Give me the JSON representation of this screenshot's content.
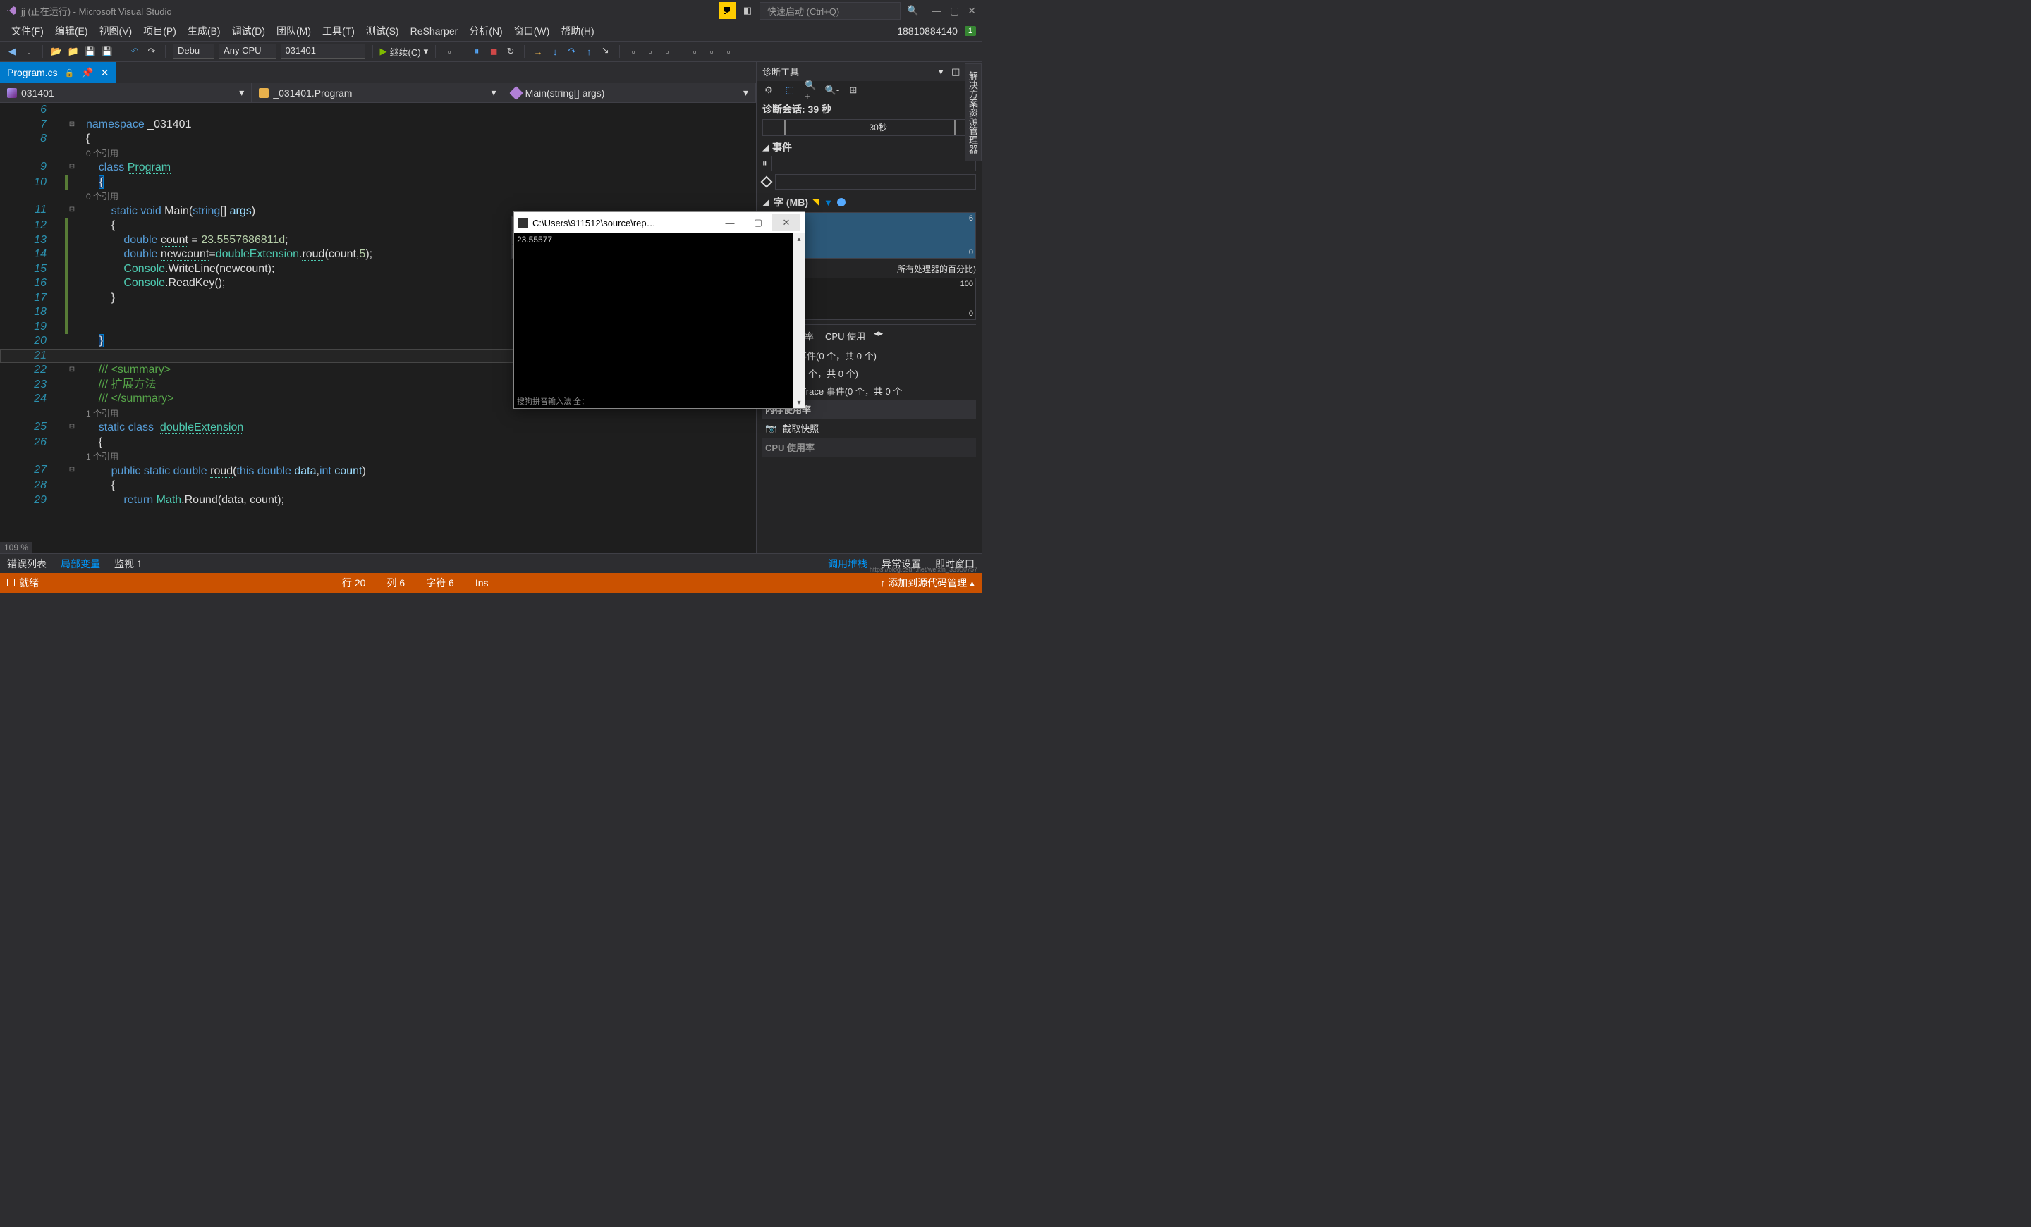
{
  "title": "jj (正在运行) - Microsoft Visual Studio",
  "quicklaunch_placeholder": "快速启动 (Ctrl+Q)",
  "user": "18810884140",
  "badge": "1",
  "menu": [
    "文件(F)",
    "编辑(E)",
    "视图(V)",
    "项目(P)",
    "生成(B)",
    "调试(D)",
    "团队(M)",
    "工具(T)",
    "测试(S)",
    "ReSharper",
    "分析(N)",
    "窗口(W)",
    "帮助(H)"
  ],
  "toolbar": {
    "config": "Debu",
    "platform": "Any CPU",
    "project": "031401",
    "continue": "继续(C)"
  },
  "tab": {
    "name": "Program.cs"
  },
  "nav": {
    "project": "031401",
    "class": "_031401.Program",
    "method": "Main(string[] args)"
  },
  "code": {
    "lines": [
      6,
      7,
      8,
      9,
      10,
      11,
      12,
      13,
      14,
      15,
      16,
      17,
      18,
      19,
      20,
      21,
      22,
      23,
      24,
      25,
      26,
      27,
      28,
      29
    ],
    "ref0": "0 个引用",
    "ref1": "1 个引用",
    "namespace": "namespace",
    "ns_name": "_031401",
    "class_kw": "class",
    "class_name": "Program",
    "static": "static",
    "void": "void",
    "main": "Main",
    "string": "string",
    "args_p": "args",
    "double": "double",
    "count_v": "count",
    "count_val": "23.5557686811d",
    "newcount": "newcount",
    "ext_class": "doubleExtension",
    "roud": "roud",
    "five": "5",
    "console": "Console",
    "writeline": "WriteLine",
    "readkey": "ReadKey",
    "summary_open": "/// <summary>",
    "summary_text": "/// 扩展方法",
    "summary_close": "/// </summary>",
    "public": "public",
    "this": "this",
    "data_p": "data",
    "int": "int",
    "return": "return",
    "math": "Math",
    "round": "Round"
  },
  "zoom": "109 %",
  "diag": {
    "title": "诊断工具",
    "session": "诊断会话: 39 秒",
    "timeline_label": "30秒",
    "events": "事件",
    "memory_header": "(MB)",
    "memory_suffix_cn": "字",
    "mem_top": "6",
    "mem_bot": "0",
    "cpu_caption": "所有处理器的百分比)",
    "cpu_top": "100",
    "cpu_bot": "0",
    "tabs": {
      "memusage": "内存使用率",
      "cpuusage": "CPU 使用"
    },
    "all_events": "所有事件(0 个，共 0 个)",
    "exceptions": "异常(0 个，共 0 个)",
    "intellitrace": "IntelliTrace 事件(0 个，共 0 个",
    "mem_section": "内存使用率",
    "snapshot": "截取快照",
    "cpu_section": "CPU 使用率"
  },
  "solution_explorer": "解决方案资源管理器",
  "bottom_tabs_left": {
    "errors": "错误列表",
    "locals": "局部变量",
    "watch": "监视 1"
  },
  "bottom_tabs_right": {
    "callstack": "调用堆栈",
    "exception": "异常设置",
    "immediate": "即时窗口"
  },
  "status": {
    "ready": "就绪",
    "line": "行 20",
    "col": "列 6",
    "char": "字符 6",
    "ins": "Ins",
    "source_control": "添加到源代码管理"
  },
  "console": {
    "title": "C:\\Users\\911512\\source\\rep…",
    "output": "23.55577",
    "ime": "搜狗拼音输入法 全："
  },
  "watermark": "https://blog.csdn.net/weixin_33950757"
}
